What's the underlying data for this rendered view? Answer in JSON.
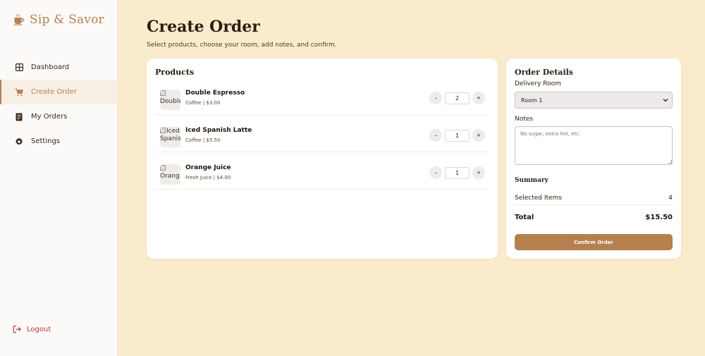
{
  "brand": {
    "name": "Sip & Savor",
    "icon": "coffee-cup-icon",
    "color": "#b5804e"
  },
  "nav": {
    "items": [
      {
        "label": "Dashboard",
        "icon": "grid-icon",
        "active": false
      },
      {
        "label": "Create Order",
        "icon": "cart-icon",
        "active": true
      },
      {
        "label": "My Orders",
        "icon": "document-icon",
        "active": false
      },
      {
        "label": "Settings",
        "icon": "gear-icon",
        "active": false
      }
    ],
    "logout_label": "Logout"
  },
  "page": {
    "title": "Create Order",
    "subtitle": "Select products, choose your room, add notes, and confirm."
  },
  "products": {
    "title": "Products",
    "items": [
      {
        "name": "Double Espresso",
        "meta": "Coffee | $3.00",
        "alt": "Double",
        "qty": "2"
      },
      {
        "name": "Iced Spanish Latte",
        "meta": "Coffee | $5.50",
        "alt": "Iced Spanis",
        "qty": "1"
      },
      {
        "name": "Orange Juice",
        "meta": "Fresh Juice | $4.00",
        "alt": "Orang",
        "qty": "1"
      }
    ],
    "minus_label": "-",
    "plus_label": "+"
  },
  "details": {
    "title": "Order Details",
    "room_label": "Delivery Room",
    "room_value": "Room 1",
    "notes_label": "Notes",
    "notes_placeholder": "No sugar, extra hot, etc.",
    "summary_title": "Summary",
    "selected_items_label": "Selected Items",
    "selected_items_value": "4",
    "total_label": "Total",
    "total_value": "$15.50",
    "confirm_label": "Confirm Order"
  },
  "colors": {
    "accent": "#b5804e",
    "background": "#faebcd",
    "danger": "#b23a36"
  }
}
